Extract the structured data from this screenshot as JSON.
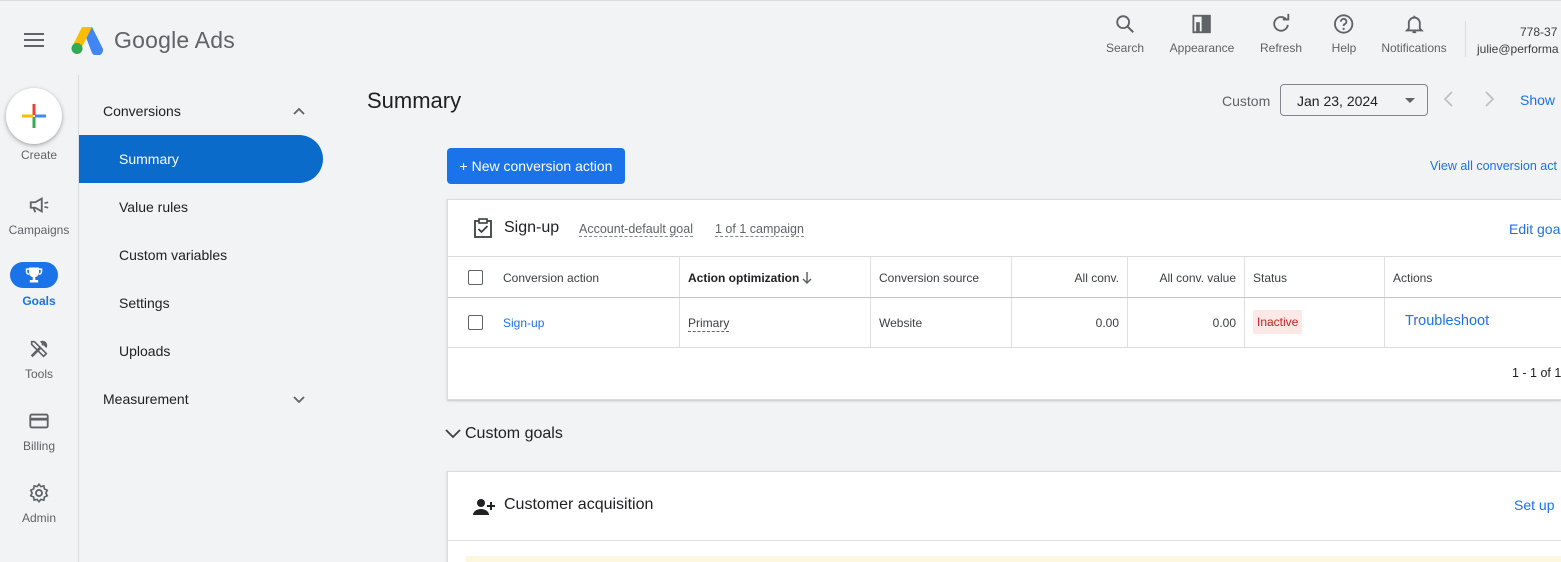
{
  "header": {
    "brand": "Google Ads",
    "tools": [
      {
        "label": "Search",
        "icon": "search-icon"
      },
      {
        "label": "Appearance",
        "icon": "appearance-icon"
      },
      {
        "label": "Refresh",
        "icon": "refresh-icon"
      },
      {
        "label": "Help",
        "icon": "help-icon"
      },
      {
        "label": "Notifications",
        "icon": "bell-icon"
      }
    ],
    "account_id": "778-37",
    "account_email": "julie@performa"
  },
  "rail": {
    "create_label": "Create",
    "items": [
      {
        "label": "Campaigns",
        "icon": "megaphone-icon"
      },
      {
        "label": "Goals",
        "icon": "trophy-icon"
      },
      {
        "label": "Tools",
        "icon": "tools-icon"
      },
      {
        "label": "Billing",
        "icon": "credit-card-icon"
      },
      {
        "label": "Admin",
        "icon": "gear-icon"
      }
    ]
  },
  "nav": {
    "conversions": "Conversions",
    "items": [
      "Summary",
      "Value rules",
      "Custom variables",
      "Settings",
      "Uploads"
    ],
    "measurement": "Measurement"
  },
  "main": {
    "title": "Summary",
    "date_label": "Custom",
    "date_value": "Jan 23, 2024",
    "show": "Show",
    "new_conversion": "+ New conversion action",
    "view_all": "View all conversion act",
    "goal_card": {
      "title": "Sign-up",
      "default_goal": "Account-default goal",
      "campaigns": "1 of 1 campaign",
      "edit": "Edit goa",
      "columns": [
        "Conversion action",
        "Action optimization",
        "Conversion source",
        "All conv.",
        "All conv. value",
        "Status",
        "Actions"
      ],
      "row": {
        "action": "Sign-up",
        "optimization": "Primary",
        "source": "Website",
        "all_conv": "0.00",
        "all_conv_value": "0.00",
        "status": "Inactive",
        "actions": "Troubleshoot"
      },
      "pager": "1 - 1 of 1"
    },
    "custom_goals": "Custom goals",
    "acquisition_card": {
      "title": "Customer acquisition",
      "setup": "Set up"
    }
  },
  "colors": {
    "accent": "#1a73e8",
    "active_nav": "#0b6bcb",
    "inactive_bg": "#fce8e6",
    "inactive_text": "#c5221f"
  }
}
